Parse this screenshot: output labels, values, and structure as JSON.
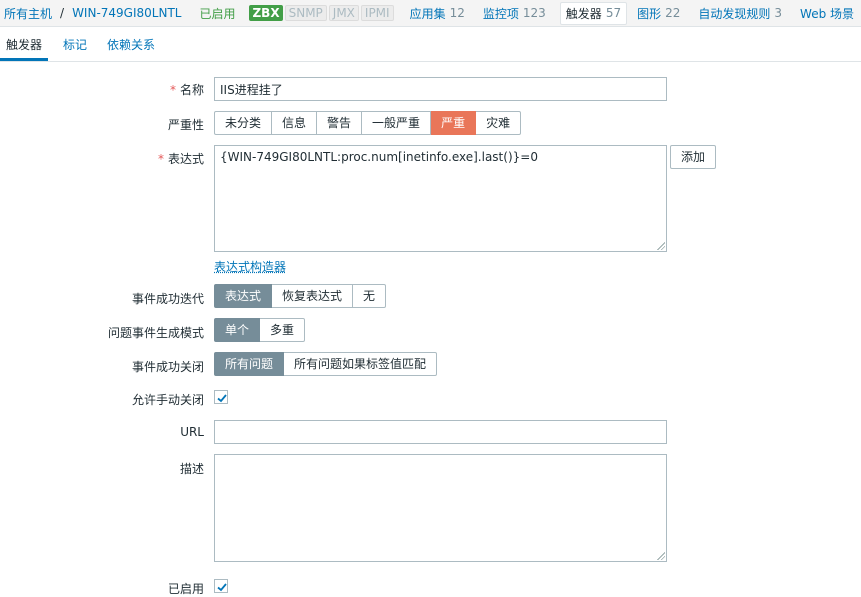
{
  "breadcrumb": {
    "all_hosts": "所有主机",
    "separator": "/",
    "host": "WIN-749GI80LNTL",
    "status": "已启用",
    "interfaces": [
      "ZBX",
      "SNMP",
      "JMX",
      "IPMI"
    ],
    "links": [
      {
        "label": "应用集",
        "count": "12"
      },
      {
        "label": "监控项",
        "count": "123"
      },
      {
        "label": "触发器",
        "count": "57"
      },
      {
        "label": "图形",
        "count": "22"
      },
      {
        "label": "自动发现规则",
        "count": "3"
      },
      {
        "label": "Web 场景",
        "count": ""
      }
    ]
  },
  "tabs": [
    "触发器",
    "标记",
    "依赖关系"
  ],
  "form": {
    "name_label": "名称",
    "name_value": "IIS进程挂了",
    "severity_label": "严重性",
    "severity_options": [
      "未分类",
      "信息",
      "警告",
      "一般严重",
      "严重",
      "灾难"
    ],
    "severity_selected": "严重",
    "expression_label": "表达式",
    "expression_value": "{WIN-749GI80LNTL:proc.num[inetinfo.exe].last()}=0",
    "add_button": "添加",
    "expression_builder": "表达式构造器",
    "ok_event_label": "事件成功迭代",
    "ok_event_options": [
      "表达式",
      "恢复表达式",
      "无"
    ],
    "problem_mode_label": "问题事件生成模式",
    "problem_mode_options": [
      "单个",
      "多重"
    ],
    "ok_close_label": "事件成功关闭",
    "ok_close_options": [
      "所有问题",
      "所有问题如果标签值匹配"
    ],
    "manual_close_label": "允许手动关闭",
    "url_label": "URL",
    "url_value": "",
    "description_label": "描述",
    "description_value": "",
    "enabled_label": "已启用"
  },
  "colors": {
    "accent": "#0275b8",
    "severity_high": "#e97659",
    "selected": "#768d99",
    "enabled": "#429e47"
  }
}
